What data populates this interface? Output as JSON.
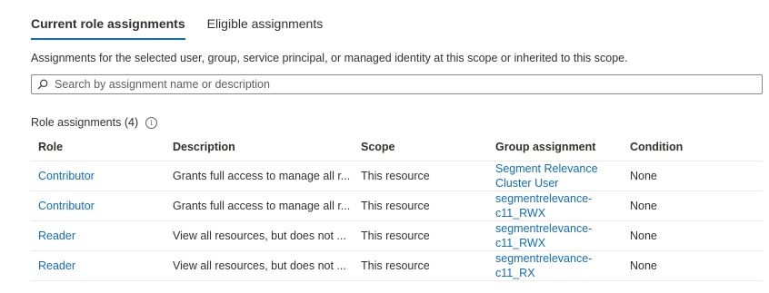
{
  "tabs": [
    {
      "label": "Current role assignments",
      "active": true
    },
    {
      "label": "Eligible assignments",
      "active": false
    }
  ],
  "description": "Assignments for the selected user, group, service principal, or managed identity at this scope or inherited to this scope.",
  "search": {
    "placeholder": "Search by assignment name or description",
    "value": ""
  },
  "role_assignments_label": "Role assignments (4)",
  "table": {
    "columns": [
      "Role",
      "Description",
      "Scope",
      "Group assignment",
      "Condition"
    ],
    "rows": [
      {
        "role": "Contributor",
        "description": "Grants full access to manage all r...",
        "scope": "This resource",
        "group": "Segment Relevance Cluster User",
        "condition": "None"
      },
      {
        "role": "Contributor",
        "description": "Grants full access to manage all r...",
        "scope": "This resource",
        "group": "segmentrelevance-c11_RWX",
        "condition": "None"
      },
      {
        "role": "Reader",
        "description": "View all resources, but does not ...",
        "scope": "This resource",
        "group": "segmentrelevance-c11_RWX",
        "condition": "None"
      },
      {
        "role": "Reader",
        "description": "View all resources, but does not ...",
        "scope": "This resource",
        "group": "segmentrelevance-c11_RX",
        "condition": "None"
      }
    ]
  },
  "colors": {
    "accent": "#0f6cbd",
    "text": "#323130",
    "border": "#8a8886"
  },
  "icons": {
    "search": "search-icon",
    "info": "info-icon"
  }
}
